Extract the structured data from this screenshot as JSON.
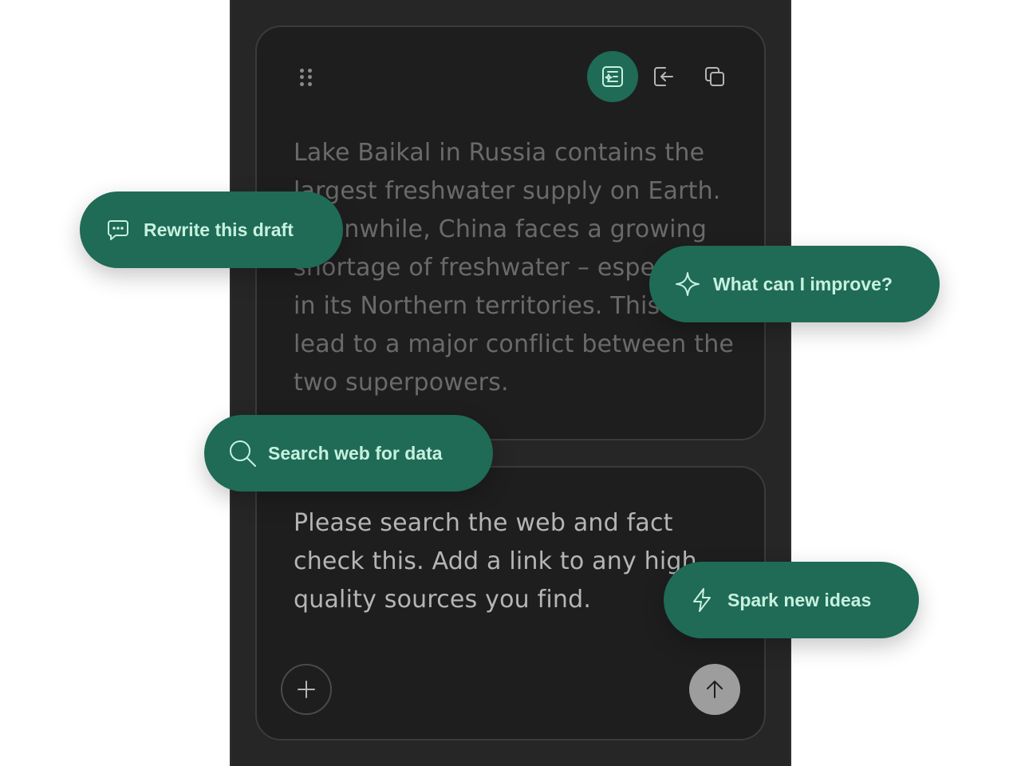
{
  "draft": {
    "text": "Lake Baikal in Russia contains the largest freshwater supply on Earth. Meanwhile, China faces a growing shortage of freshwater – especially in its Northern territories. This could lead to a major conflict between the two superpowers."
  },
  "prompt": {
    "text": "Please search the web and fact check this. Add a link to any high quality sources you find."
  },
  "toolbar": {
    "icons": [
      "drag-handle-icon",
      "review-sparkle-icon",
      "insert-icon",
      "copy-icon"
    ]
  },
  "suggestions": {
    "rewrite": "Rewrite this draft",
    "improve": "What can I improve?",
    "search": "Search web for data",
    "spark": "Spark new ideas"
  },
  "colors": {
    "accent": "#1f6b55",
    "accent_text": "#c7f0df",
    "panel_bg": "#262626",
    "card_bg": "#1e1e1e",
    "draft_text": "#6a6a6a",
    "prompt_text": "#b5b5b5"
  }
}
